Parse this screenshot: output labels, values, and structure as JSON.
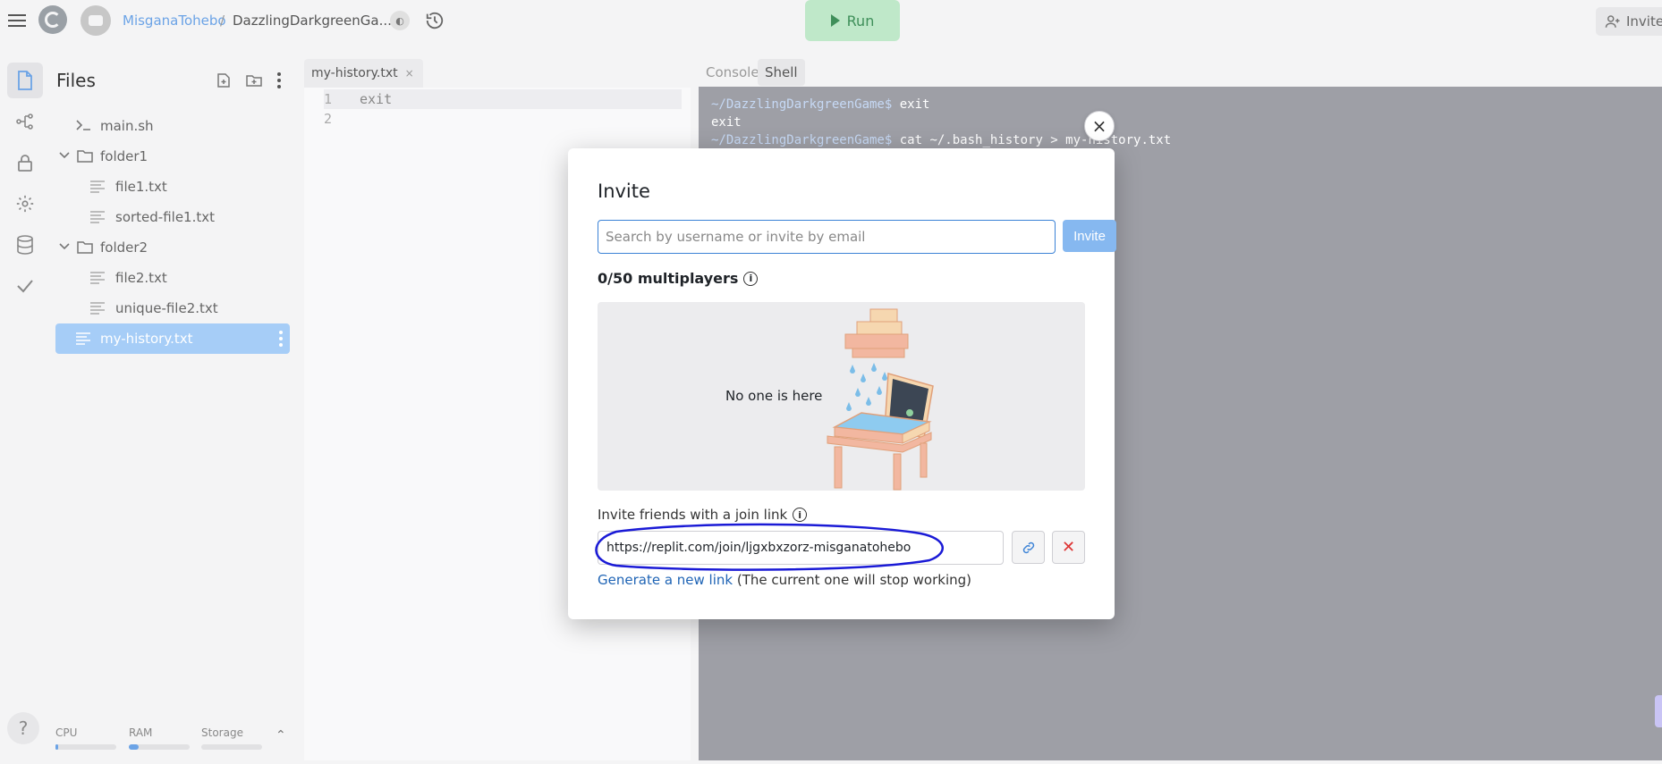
{
  "topbar": {
    "username": "MisganaTohebo",
    "separator": "/",
    "repl_name": "DazzlingDarkgreenGa...",
    "run_label": "Run",
    "invite_label": "Invite"
  },
  "sidebar": {
    "title": "Files",
    "tree": [
      {
        "label": "main.sh",
        "type": "shell-file",
        "depth": 0
      },
      {
        "label": "folder1",
        "type": "folder",
        "depth": 0
      },
      {
        "label": "file1.txt",
        "type": "file",
        "depth": 1
      },
      {
        "label": "sorted-file1.txt",
        "type": "file",
        "depth": 1
      },
      {
        "label": "folder2",
        "type": "folder",
        "depth": 0
      },
      {
        "label": "file2.txt",
        "type": "file",
        "depth": 1
      },
      {
        "label": "unique-file2.txt",
        "type": "file",
        "depth": 1
      },
      {
        "label": "my-history.txt",
        "type": "file",
        "depth": 0,
        "selected": true
      }
    ],
    "resources": {
      "cpu_label": "CPU",
      "ram_label": "RAM",
      "storage_label": "Storage"
    },
    "help_label": "?"
  },
  "editor": {
    "tab_label": "my-history.txt",
    "lines": [
      {
        "num": "1",
        "text": "exit"
      },
      {
        "num": "2",
        "text": ""
      }
    ]
  },
  "shell": {
    "tabs": [
      "Console",
      "Shell"
    ],
    "active_tab": "Shell",
    "lines": [
      {
        "prompt": "~/DazzlingDarkgreenGame$",
        "cmd": " exit"
      },
      {
        "prompt": "",
        "cmd": "exit"
      },
      {
        "prompt": "~/DazzlingDarkgreenGame$",
        "cmd": " cat ~/.bash_history > my-history.txt"
      }
    ]
  },
  "modal": {
    "title": "Invite",
    "search_placeholder": "Search by username or invite by email",
    "invite_button": "Invite",
    "multiplayers": "0/50 multiplayers",
    "empty_text": "No one is here",
    "join_label": "Invite friends with a join link",
    "join_link": "https://replit.com/join/ljgxbxzorz-misganatohebo",
    "generate_link": "Generate a new link",
    "generate_note": " (The current one will stop working)",
    "close_label": "×"
  },
  "colors": {
    "accent": "#3b82d6",
    "selected_file": "#a6cdf7",
    "terminal_bg": "#9e9fa6",
    "annotation_ink": "#1a1ad6"
  }
}
